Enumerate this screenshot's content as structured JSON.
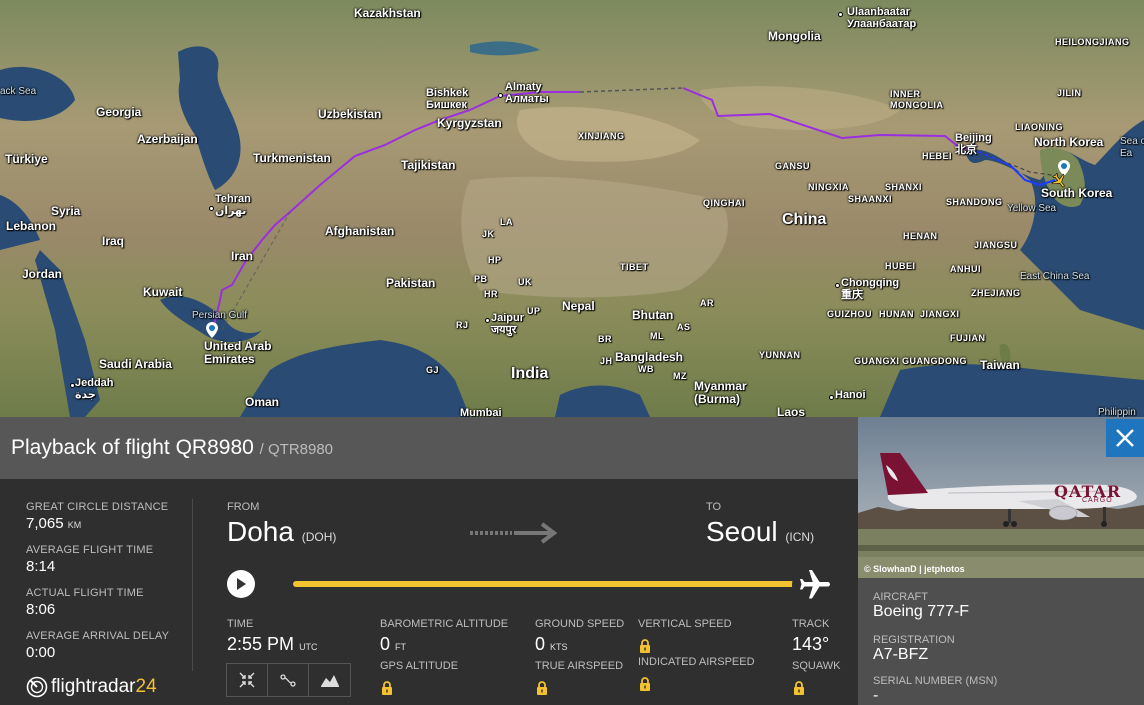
{
  "map": {
    "labels": {
      "kazakhstan": "Kazakhstan",
      "mongolia": "Mongolia",
      "ulaanbaatar_en": "Ulaanbaatar",
      "ulaanbaatar_mn": "Улаанбаатар",
      "heilongjiang": "HEILONGJIANG",
      "jilin": "JILIN",
      "liaoning": "LIAONING",
      "inner_mongolia": "INNER\nMONGOLIA",
      "black_sea": "ack Sea",
      "georgia": "Georgia",
      "azerbaijan": "Azerbaijan",
      "turkiye": "Türkiye",
      "uzbekistan": "Uzbekistan",
      "turkmenistan": "Turkmenistan",
      "kyrgyzstan": "Kyrgyzstan",
      "tajikistan": "Tajikistan",
      "bishkek_en": "Bishkek",
      "bishkek_ru": "Бишкек",
      "almaty_en": "Almaty",
      "almaty_ru": "Алматы",
      "xinjiang": "XINJIANG",
      "gansu": "GANSU",
      "beijing_en": "Beijing",
      "beijing_zh": "北京",
      "hebei": "HEBEI",
      "north_korea": "North Korea",
      "south_korea": "South Korea",
      "sea_of_japan": "Sea o\nEa",
      "yellow_sea": "Yellow Sea",
      "syria": "Syria",
      "lebanon": "Lebanon",
      "iraq": "Iraq",
      "tehran_en": "Tehran",
      "tehran_fa": "تهران",
      "afghanistan": "Afghanistan",
      "iran": "Iran",
      "jordan": "Jordan",
      "kuwait": "Kuwait",
      "pakistan": "Pakistan",
      "ningxia": "NINGXIA",
      "shaanxi": "SHAANXI",
      "shanxi": "SHANXI",
      "qinghai": "QINGHAI",
      "china": "China",
      "shandong": "SHANDONG",
      "henan": "HENAN",
      "jiangsu": "JIANGSU",
      "hubei": "HUBEI",
      "anhui": "ANHUI",
      "east_china_sea": "East China Sea",
      "zhejiang": "ZHEJIANG",
      "tibet": "TIBET",
      "chongqing_en": "Chongqing",
      "chongqing_zh": "重庆",
      "persian_gulf": "Persian Gulf",
      "uae": "United Arab\nEmirates",
      "saudi_arabia": "Saudi Arabia",
      "jeddah_en": "Jeddah",
      "jeddah_ar": "جدة",
      "oman": "Oman",
      "jaipur_en": "Jaipur",
      "jaipur_hi": "जयपुर",
      "nepal": "Nepal",
      "bhutan": "Bhutan",
      "india": "India",
      "bangladesh": "Bangladesh",
      "myanmar": "Myanmar\n(Burma)",
      "guizhou": "GUIZHOU",
      "hunan": "HUNAN",
      "jiangxi": "JIANGXI",
      "fujian": "FUJIAN",
      "guangdong": "GUANGDONG",
      "guangxi": "GUANGXI",
      "yunnan": "YUNNAN",
      "taiwan": "Taiwan",
      "hanoi": "Hanoi",
      "mumbai": "Mumbai",
      "laos": "Laos",
      "philippines": "Philippin",
      "jk": "JK",
      "pb": "PB",
      "hr": "HR",
      "up": "UP",
      "rj": "RJ",
      "gj": "GJ",
      "br": "BR",
      "jh": "JH",
      "wb": "WB",
      "mz": "MZ",
      "as": "AS",
      "ar": "AR",
      "la": "LA",
      "hp": "HP",
      "uk": "UK",
      "ml": "ML"
    }
  },
  "panel": {
    "title": "Playback of flight QR8980",
    "callsign": "/ QTR8980",
    "stats": [
      {
        "label": "GREAT CIRCLE DISTANCE",
        "value": "7,065",
        "unit": "KM"
      },
      {
        "label": "AVERAGE FLIGHT TIME",
        "value": "8:14",
        "unit": ""
      },
      {
        "label": "ACTUAL FLIGHT TIME",
        "value": "8:06",
        "unit": ""
      },
      {
        "label": "AVERAGE ARRIVAL DELAY",
        "value": "0:00",
        "unit": ""
      }
    ],
    "from_label": "FROM",
    "from_city": "Doha",
    "from_code": "(DOH)",
    "to_label": "TO",
    "to_city": "Seoul",
    "to_code": "(ICN)",
    "progress": 1.0,
    "time_label": "TIME",
    "time_value": "2:55 PM",
    "time_unit": "UTC",
    "baro_alt_label": "BAROMETRIC ALTITUDE",
    "baro_alt_value": "0",
    "baro_alt_unit": "FT",
    "gps_alt_label": "GPS ALTITUDE",
    "ground_speed_label": "GROUND SPEED",
    "ground_speed_value": "0",
    "ground_speed_unit": "KTS",
    "true_airspeed_label": "TRUE AIRSPEED",
    "vertical_speed_label": "VERTICAL SPEED",
    "indicated_airspeed_label": "INDICATED AIRSPEED",
    "track_label": "TRACK",
    "track_value": "143°",
    "squawk_label": "SQUAWK",
    "logo_text": "flightradar",
    "logo_num": "24"
  },
  "aircraft": {
    "photo_credit": "© SlowhanD | jetphotos",
    "photo_brand": "QATAR",
    "photo_brand_sub": "CARGO",
    "aircraft_label": "AIRCRAFT",
    "aircraft_value": "Boeing 777-F",
    "registration_label": "REGISTRATION",
    "registration_value": "A7-BFZ",
    "serial_label": "SERIAL NUMBER (MSN)",
    "serial_value": "-"
  },
  "colors": {
    "route": "#9b2fe0",
    "accent": "#f2c230",
    "close": "#1f76bf"
  }
}
